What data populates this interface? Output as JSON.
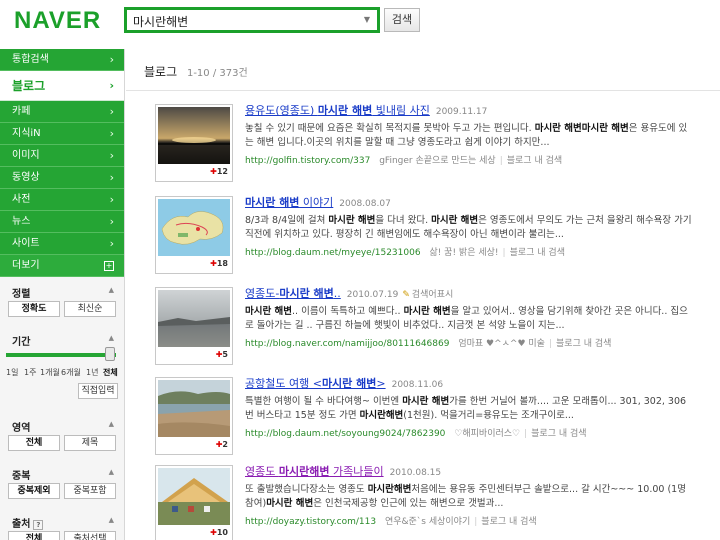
{
  "logo": "NAVER",
  "search": {
    "query": "마시란해변",
    "button": "검색"
  },
  "nav": {
    "items": [
      {
        "label": "통합검색"
      },
      {
        "label": "블로그",
        "active": true
      },
      {
        "label": "카페"
      },
      {
        "label": "지식iN"
      },
      {
        "label": "이미지"
      },
      {
        "label": "동영상"
      },
      {
        "label": "사전"
      },
      {
        "label": "뉴스"
      },
      {
        "label": "사이트"
      }
    ],
    "more": "더보기"
  },
  "filters": {
    "sort": {
      "title": "정렬",
      "options": [
        "정확도",
        "최신순"
      ]
    },
    "period": {
      "title": "기간",
      "options": [
        "1일",
        "1주",
        "1개월",
        "6개월",
        "1년",
        "전체"
      ],
      "selected": "전체",
      "direct": "직접입력"
    },
    "area": {
      "title": "영역",
      "options": [
        "전체",
        "제목"
      ]
    },
    "dup": {
      "title": "중복",
      "options": [
        "중복제외",
        "중복포함"
      ]
    },
    "source": {
      "title": "출처",
      "options": [
        "전체",
        "출처선택"
      ]
    }
  },
  "results_header": {
    "title": "블로그",
    "count": "1-10 / 373건"
  },
  "results": [
    {
      "title_pre": "용유도(영종도) ",
      "title_hl": "마시란 해변",
      "title_post": " 빛내림 사진",
      "date": "2009.11.17",
      "desc_parts": [
        "놓칠 수 있기 때문에 요즘은 확실히 목적지를 못박아 두고 가는 편입니다. ",
        "마시란 해변마시란 해변",
        "은 용유도에 있는 해변 입니다.이곳의 위치를 말할 때 그냥 영종도라고 쉽게 이야기 하지만..."
      ],
      "url": "http://golfin.tistory.com/337",
      "blog": "gFinger 손끝으로 만드는 세상",
      "in_blog": "블로그 내 검색",
      "count": "12"
    },
    {
      "title_pre": "",
      "title_hl": "마시란 해변",
      "title_post": " 이야기",
      "date": "2008.08.07",
      "desc_parts": [
        "8/3과 8/4일에 걸쳐 ",
        "마시란 해변",
        "을 다녀 왔다. ",
        "마시란 해변",
        "은 영종도에서 무의도 가는 근처 을왕리 해수욕장 가기 직전에 위치하고 있다. 평장히 긴 해변임에도 해수욕장이 아닌 해변이라 불리는..."
      ],
      "url": "http://blog.daum.net/myeye/15231006",
      "blog": "삶! 꿈! 밝은 세상!",
      "in_blog": "블로그 내 검색",
      "count": "18"
    },
    {
      "title_pre": "영종도-",
      "title_hl": "마시란 해변",
      "title_post": "..",
      "date": "2010.07.19",
      "source_tag": "검색어표시",
      "desc_parts": [
        "",
        "마시란 해변",
        ".. 이름이 독특하고 예쁘다.. ",
        "마시란 해변",
        "을 알고 있어서.. 영상을 담기위해 찾아간 곳은 아니다.. 집으로 돌아가는 길 .. 구름진 하늘에 햇빛이 비추었다.. 지금껏 본 석양 노을이 지는..."
      ],
      "url": "http://blog.naver.com/namijjoo/80111646869",
      "blog": "엄마표 ♥^ㅅ^♥ 미술",
      "in_blog": "블로그 내 검색",
      "count": "5"
    },
    {
      "title_pre": "공항철도 여행 <",
      "title_hl": "마시란 해변",
      "title_post": ">",
      "date": "2008.11.06",
      "desc_parts": [
        "특별한 여행이 될 수 바다여행~ 이번엔 ",
        "마시란 해변",
        "가를 한번 거닐어 볼까.... 고운 모래톱이... 301, 302, 306번 버스타고 15분 정도 가면 ",
        "마시란해변",
        "(1천원). 먹을거리=용유도는 조개구이로..."
      ],
      "url": "http://blog.daum.net/soyoung9024/7862390",
      "blog": "♡해피바이러스♡",
      "in_blog": "블로그 내 검색",
      "count": "2"
    },
    {
      "title_pre": "영종도 ",
      "title_hl": "마시란해변",
      "title_post": " 가족나들이",
      "date": "2010.08.15",
      "visited": true,
      "desc_parts": [
        "또 출발했습니다장소는 영종도 ",
        "마시란해변",
        "처음에는 용유동 주민센터부근 솔밭으로... 갈 시간~~~ 10.00 (1명 참여)",
        "마시란 해변",
        "은 인천국제공항 인근에 있는 해변으로 갯벌과..."
      ],
      "url": "http://doyazy.tistory.com/113",
      "blog": "연우&준`s 세상이야기",
      "in_blog": "블로그 내 검색",
      "count": "10"
    }
  ],
  "icons": {
    "dropdown": "triangle-down",
    "chevron": "chevron-right",
    "plus": "plus-square",
    "badge": "plus-cross"
  }
}
